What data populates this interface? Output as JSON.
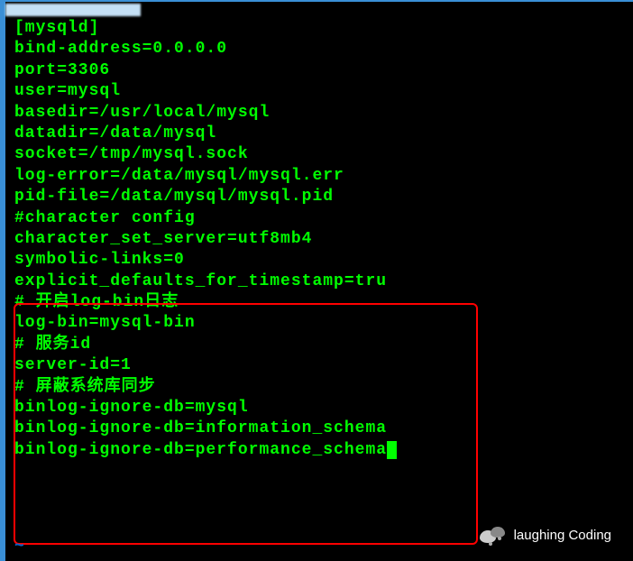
{
  "config": {
    "lines": [
      "[mysqld]",
      "bind-address=0.0.0.0",
      "port=3306",
      "user=mysql",
      "basedir=/usr/local/mysql",
      "datadir=/data/mysql",
      "socket=/tmp/mysql.sock",
      "log-error=/data/mysql/mysql.err",
      "pid-file=/data/mysql/mysql.pid",
      "#character config",
      "character_set_server=utf8mb4",
      "symbolic-links=0",
      "explicit_defaults_for_timestamp=tru",
      "",
      "# 开启log-bin日志",
      "log-bin=mysql-bin",
      "# 服务id",
      "server-id=1",
      "# 屏蔽系统库同步",
      "binlog-ignore-db=mysql",
      "binlog-ignore-db=information_schema",
      "binlog-ignore-db=performance_schema"
    ]
  },
  "watermark": {
    "text": "laughing Coding"
  },
  "tilde": "~"
}
